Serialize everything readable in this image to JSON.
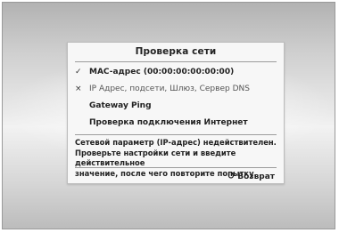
{
  "dialog": {
    "title": "Проверка сети",
    "items": [
      {
        "status": "done",
        "mark": "✓",
        "label": "MAC-адрес (00:00:00:00:00:00)"
      },
      {
        "status": "fail",
        "mark": "×",
        "label": "IP Адрес, подсети, Шлюз, Сервер DNS"
      },
      {
        "status": "pending",
        "mark": "",
        "label": "Gateway Ping"
      },
      {
        "status": "pending",
        "mark": "",
        "label": "Проверка подключения Интернет"
      }
    ],
    "message_lines": [
      "Сетевой параметр (IP-адрес) недействителен.",
      "Проверьте настройки сети и введите действительное",
      "значение, после чего повторите попытку."
    ],
    "return_label": "Возврат",
    "return_icon": "return-icon"
  }
}
